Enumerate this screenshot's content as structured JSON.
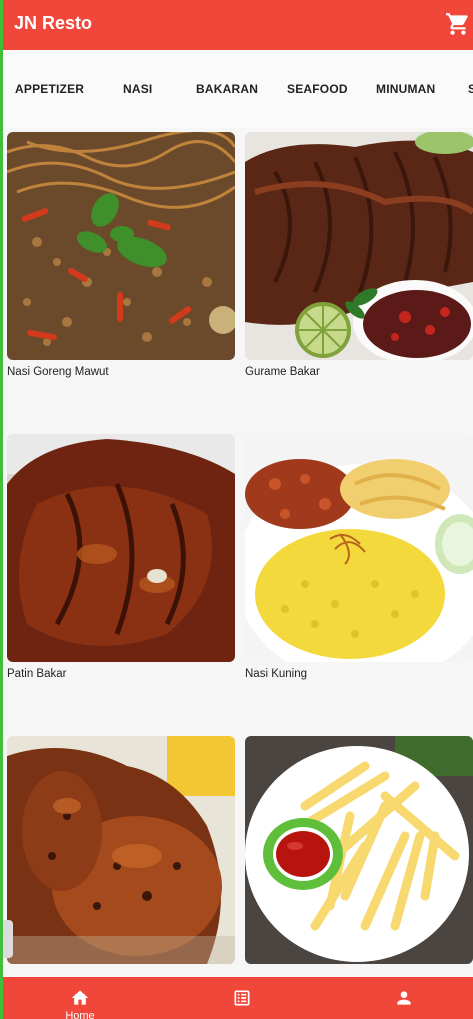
{
  "app": {
    "title": "JN Resto",
    "cart_icon": "shopping-cart-icon"
  },
  "categories": [
    {
      "label": "APPETIZER"
    },
    {
      "label": "NASI"
    },
    {
      "label": "BAKARAN"
    },
    {
      "label": "SEAFOOD"
    },
    {
      "label": "MINUMAN"
    },
    {
      "label": "S"
    }
  ],
  "menu_items": [
    {
      "name": "Nasi Goreng Mawut",
      "image": "fried-noodle-rice-photo"
    },
    {
      "name": "Gurame Bakar",
      "image": "grilled-fish-photo"
    },
    {
      "name": "Patin Bakar",
      "image": "grilled-catfish-photo"
    },
    {
      "name": "Nasi Kuning",
      "image": "yellow-rice-photo"
    },
    {
      "name": "",
      "image": "roast-chicken-photo"
    },
    {
      "name": "",
      "image": "french-fries-photo"
    }
  ],
  "bottom_nav": [
    {
      "label": "Home",
      "icon": "home-icon"
    },
    {
      "label": "",
      "icon": "list-icon"
    },
    {
      "label": "",
      "icon": "person-icon"
    }
  ],
  "colors": {
    "primary": "#f0473a",
    "background": "#f6f6f6",
    "text": "#222222"
  }
}
